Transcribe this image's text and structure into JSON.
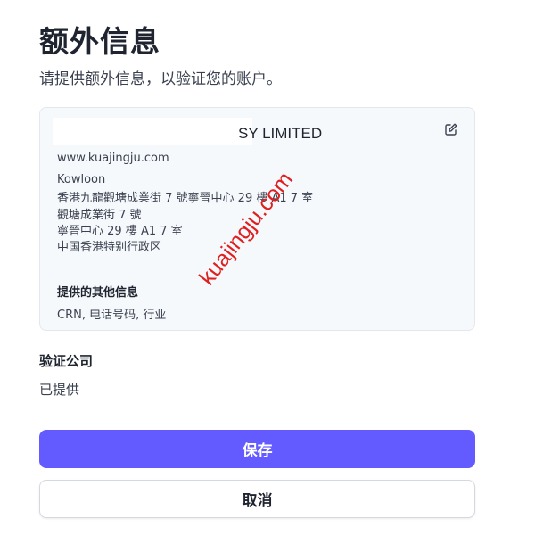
{
  "page": {
    "title": "额外信息",
    "subtitle": "请提供额外信息，以验证您的账户。"
  },
  "card": {
    "company_name_visible": "SY LIMITED",
    "website": "www.kuajingju.com",
    "address_lines": [
      "Kowloon",
      "香港九龍觀塘成業街 7 號寧晉中心 29 樓 A1 7 室",
      "觀塘成業街 7 號",
      "寧晉中心 29 樓 A1 7 室",
      "中国香港特别行政区"
    ],
    "other_info_label": "提供的其他信息",
    "other_info_value": "CRN, 电话号码, 行业",
    "edit_icon": "edit-pencil-icon"
  },
  "verify": {
    "heading": "验证公司",
    "value": "已提供"
  },
  "buttons": {
    "save": "保存",
    "cancel": "取消"
  },
  "watermark": "kuajingju.com",
  "colors": {
    "primary": "#635bff",
    "card_bg": "#f6f9fc",
    "watermark": "#e02020"
  }
}
